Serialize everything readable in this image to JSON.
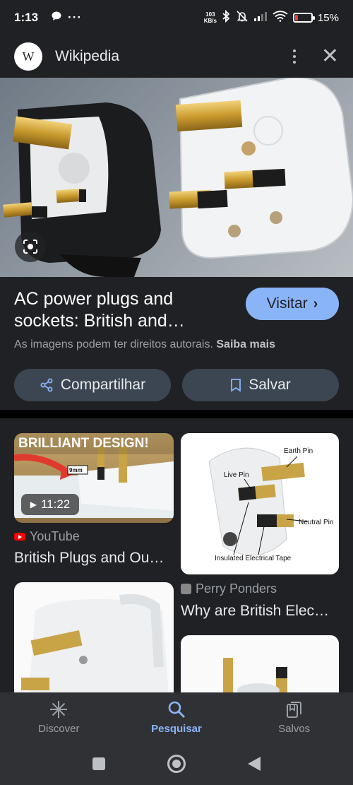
{
  "status_bar": {
    "time": "1:13",
    "net_speed_value": "103",
    "net_speed_unit": "KB/s",
    "battery_percent": "15%",
    "battery_level": 0.15
  },
  "header": {
    "logo_letter": "W",
    "title": "Wikipedia"
  },
  "info": {
    "title_line1": "AC power plugs and",
    "title_line2": "sockets: British and…",
    "visit_label": "Visitar",
    "copyright_text": "As imagens podem ter direitos autorais.",
    "learn_more": "Saiba mais",
    "share_label": "Compartilhar",
    "save_label": "Salvar"
  },
  "results": [
    {
      "banner": "BRILLIANT DESIGN!",
      "measure_label": "9mm",
      "duration": "11:22",
      "source": "YouTube",
      "title": "British Plugs and Ou…"
    },
    {
      "labels": [
        "Earth Pin",
        "Live Pin",
        "Neutral Pin",
        "Insulated Electrical Tape"
      ],
      "source": "Perry Ponders",
      "title": "Why are British Elec…"
    }
  ],
  "bottom_nav": {
    "items": [
      {
        "label": "Discover",
        "icon": "asterisk-icon"
      },
      {
        "label": "Pesquisar",
        "icon": "search-icon",
        "active": true
      },
      {
        "label": "Salvos",
        "icon": "collections-icon"
      }
    ]
  },
  "colors": {
    "accent": "#8ab4f8",
    "surface": "#202124",
    "button_bg": "#3c4652"
  }
}
